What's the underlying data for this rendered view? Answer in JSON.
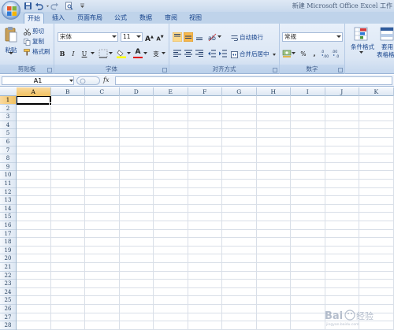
{
  "window": {
    "title": "新建 Microsoft Office Excel 工作"
  },
  "tabs": [
    {
      "label": "开始",
      "active": true
    },
    {
      "label": "插入",
      "active": false
    },
    {
      "label": "页面布局",
      "active": false
    },
    {
      "label": "公式",
      "active": false
    },
    {
      "label": "数据",
      "active": false
    },
    {
      "label": "审阅",
      "active": false
    },
    {
      "label": "视图",
      "active": false
    }
  ],
  "ribbon": {
    "clipboard": {
      "group_label": "剪贴板",
      "paste_label": "粘贴",
      "cut_label": "剪切",
      "copy_label": "复制",
      "format_painter_label": "格式刷"
    },
    "font": {
      "group_label": "字体",
      "font_name": "宋体",
      "font_size": "11",
      "grow_label": "A",
      "shrink_label": "A",
      "bold_label": "B",
      "italic_label": "I",
      "underline_label": "U",
      "font_color_label": "A",
      "wen_label": "变"
    },
    "alignment": {
      "group_label": "对齐方式",
      "wrap_label": "自动换行",
      "merge_label": "合并后居中"
    },
    "number": {
      "group_label": "数字",
      "format": "常规",
      "percent_label": "%",
      "comma_label": ","
    },
    "styles": {
      "conditional_label": "条件格式",
      "table_label": "套用",
      "table_label2": "表格格式"
    }
  },
  "formula_bar": {
    "name_box": "A1",
    "fx_label": "fx",
    "value": ""
  },
  "grid": {
    "columns": [
      "A",
      "B",
      "C",
      "D",
      "E",
      "F",
      "G",
      "H",
      "I",
      "J",
      "K"
    ],
    "rows": [
      "1",
      "2",
      "3",
      "4",
      "5",
      "6",
      "7",
      "8",
      "9",
      "10",
      "11",
      "12",
      "13",
      "14",
      "15",
      "16",
      "17",
      "18",
      "19",
      "20",
      "21",
      "22",
      "23",
      "24",
      "25",
      "26",
      "27",
      "28"
    ],
    "selected_cell": "A1"
  },
  "watermark": {
    "text": "Baidu 经验"
  },
  "colors": {
    "ribbon_bg": "#dbe6f4",
    "selection_header": "#f1c15f",
    "text_blue": "#15428b"
  }
}
